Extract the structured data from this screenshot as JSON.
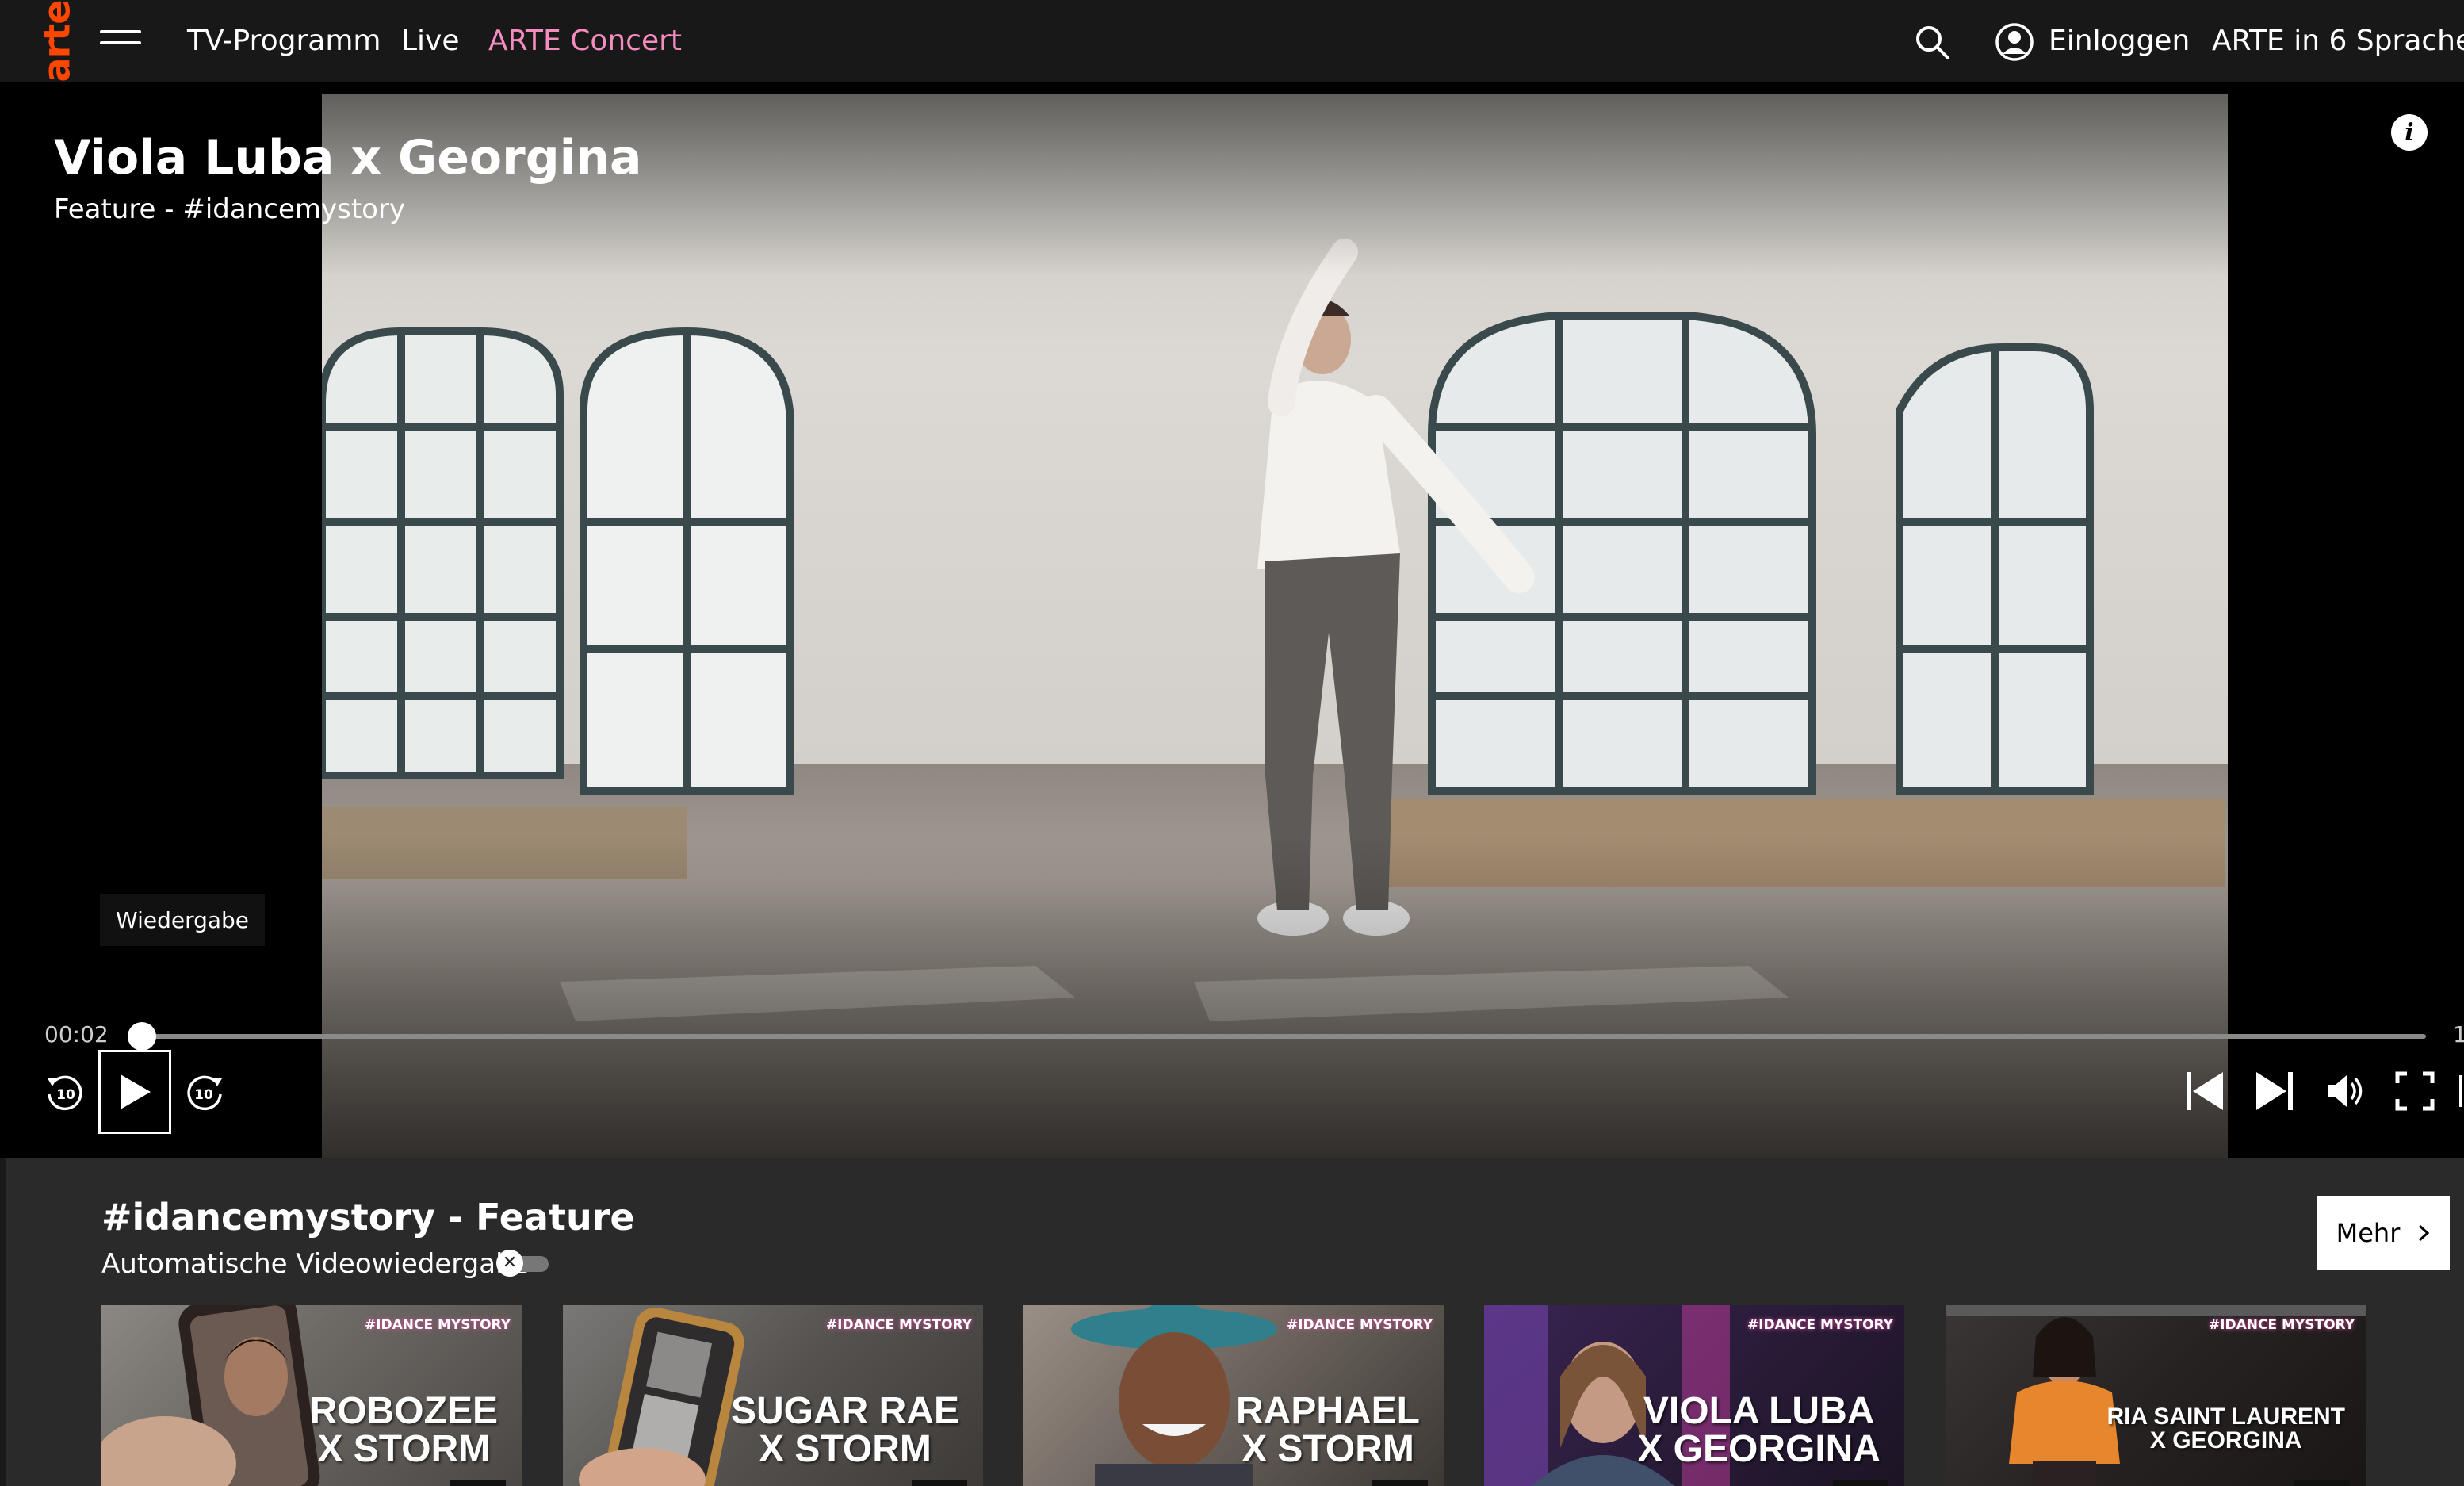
{
  "header": {
    "logo": "arte",
    "nav": [
      {
        "label": "TV-Programm"
      },
      {
        "label": "Live"
      },
      {
        "label": "ARTE Concert"
      }
    ],
    "login_label": "Einloggen",
    "languages_label": "ARTE in 6 Sprachen",
    "accent_color": "#f58bbf",
    "logo_color": "#fd4600"
  },
  "player": {
    "title": "Viola Luba x Georgina",
    "subtitle": "Feature - #idancemystory",
    "tooltip": "Wiedergabe",
    "time_current": "00:02",
    "time_end_partial": "1",
    "progress_percent": 0.1,
    "info_label": "i",
    "icons": [
      "rewind-10-icon",
      "play-icon",
      "forward-10-icon",
      "skip-previous-icon",
      "skip-next-icon",
      "volume-icon",
      "fullscreen-icon"
    ]
  },
  "collection": {
    "title": "#idancemystory - Feature",
    "autoplay_label": "Automatische Videowiedergabe",
    "autoplay_enabled": false,
    "more_label": "Mehr",
    "cards": [
      {
        "name": "ROBOZEE\nX STORM",
        "tag": "#IDANCE\nMYSTORY"
      },
      {
        "name": "SUGAR RAE\nX STORM",
        "tag": "#IDANCE\nMYSTORY"
      },
      {
        "name": "RAPHAEL\nX STORM",
        "tag": "#IDANCE\nMYSTORY"
      },
      {
        "name": "VIOLA LUBA\nX GEORGINA",
        "tag": "#IDANCE\nMYSTORY"
      },
      {
        "name": "RIA SAINT LAURENT\nX GEORGINA",
        "tag": "#IDANCE\nMYSTORY"
      }
    ]
  }
}
